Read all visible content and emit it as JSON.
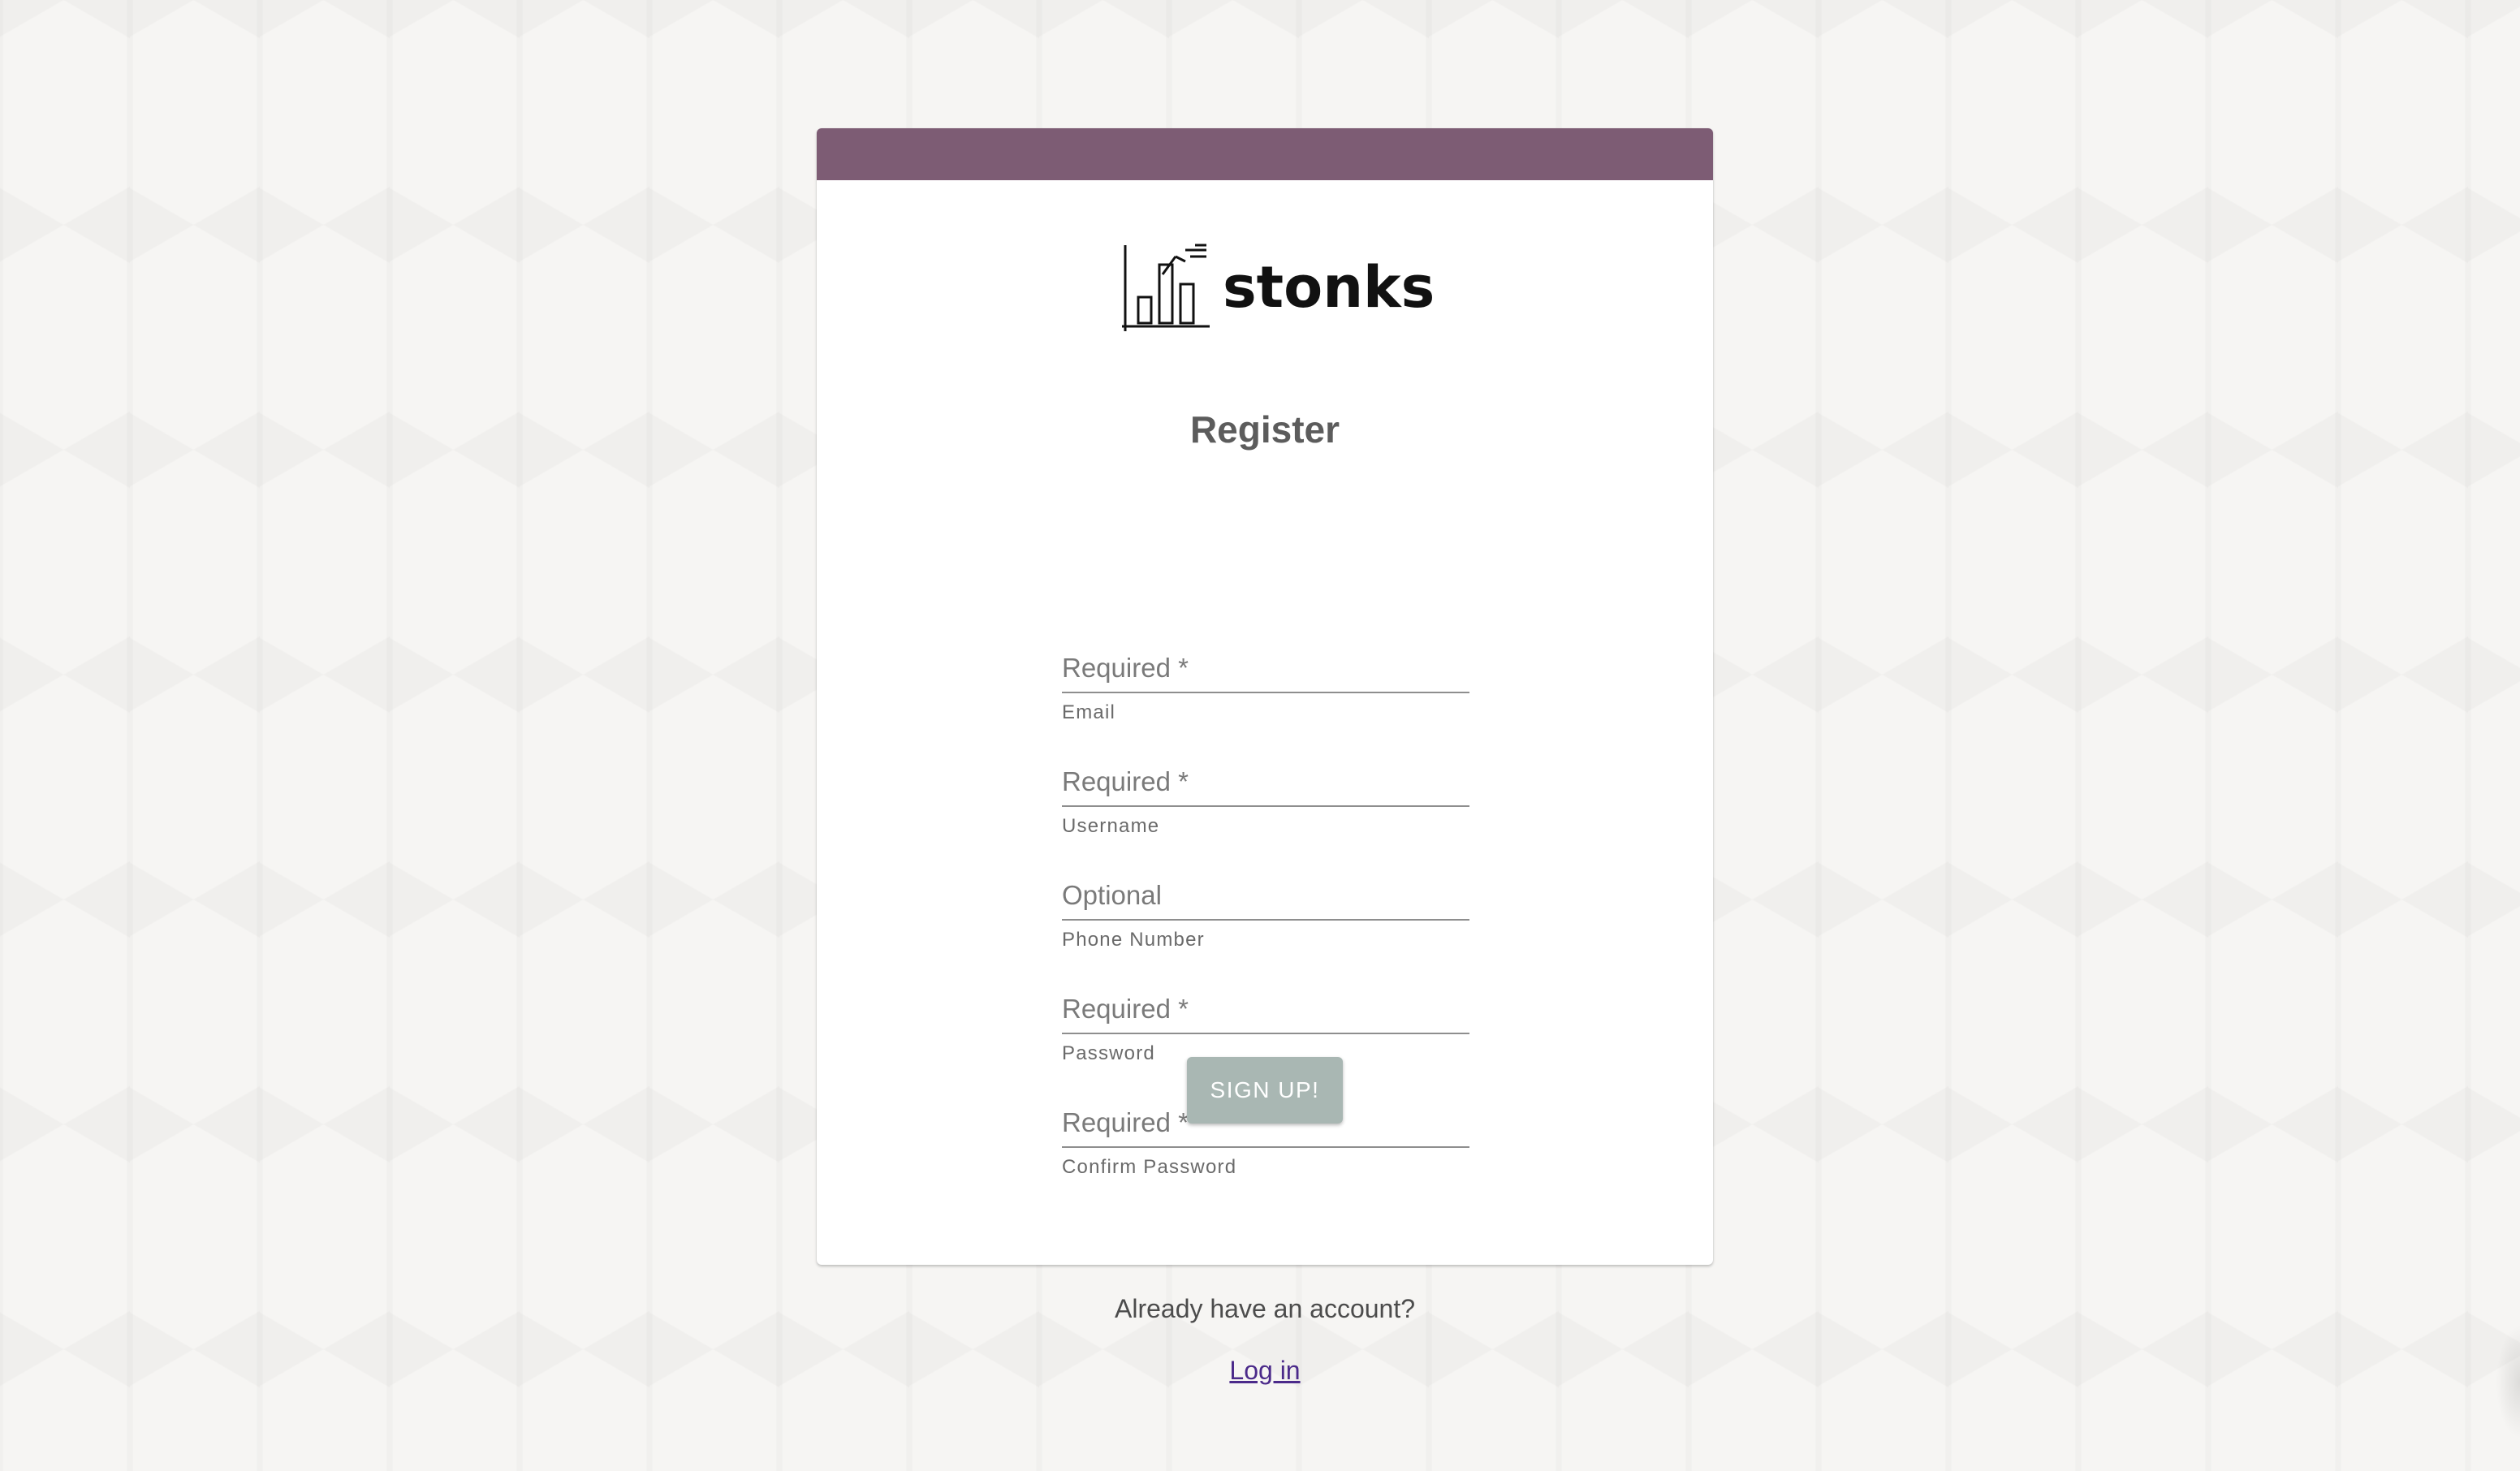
{
  "brand": {
    "name": "stonks",
    "logo_icon": "bar-chart-icon",
    "header_color": "#7d5c74"
  },
  "form": {
    "title": "Register",
    "fields": [
      {
        "placeholder": "Required *",
        "helper": "Email"
      },
      {
        "placeholder": "Required *",
        "helper": "Username"
      },
      {
        "placeholder": "Optional",
        "helper": "Phone Number"
      },
      {
        "placeholder": "Required *",
        "helper": "Password"
      },
      {
        "placeholder": "Required *",
        "helper": "Confirm Password"
      }
    ],
    "submit_label": "SIGN UP!",
    "submit_color": "#a9b7b3"
  },
  "footer": {
    "prompt": "Already have an account?",
    "login_link": "Log in",
    "link_color": "#4b2a8a"
  }
}
